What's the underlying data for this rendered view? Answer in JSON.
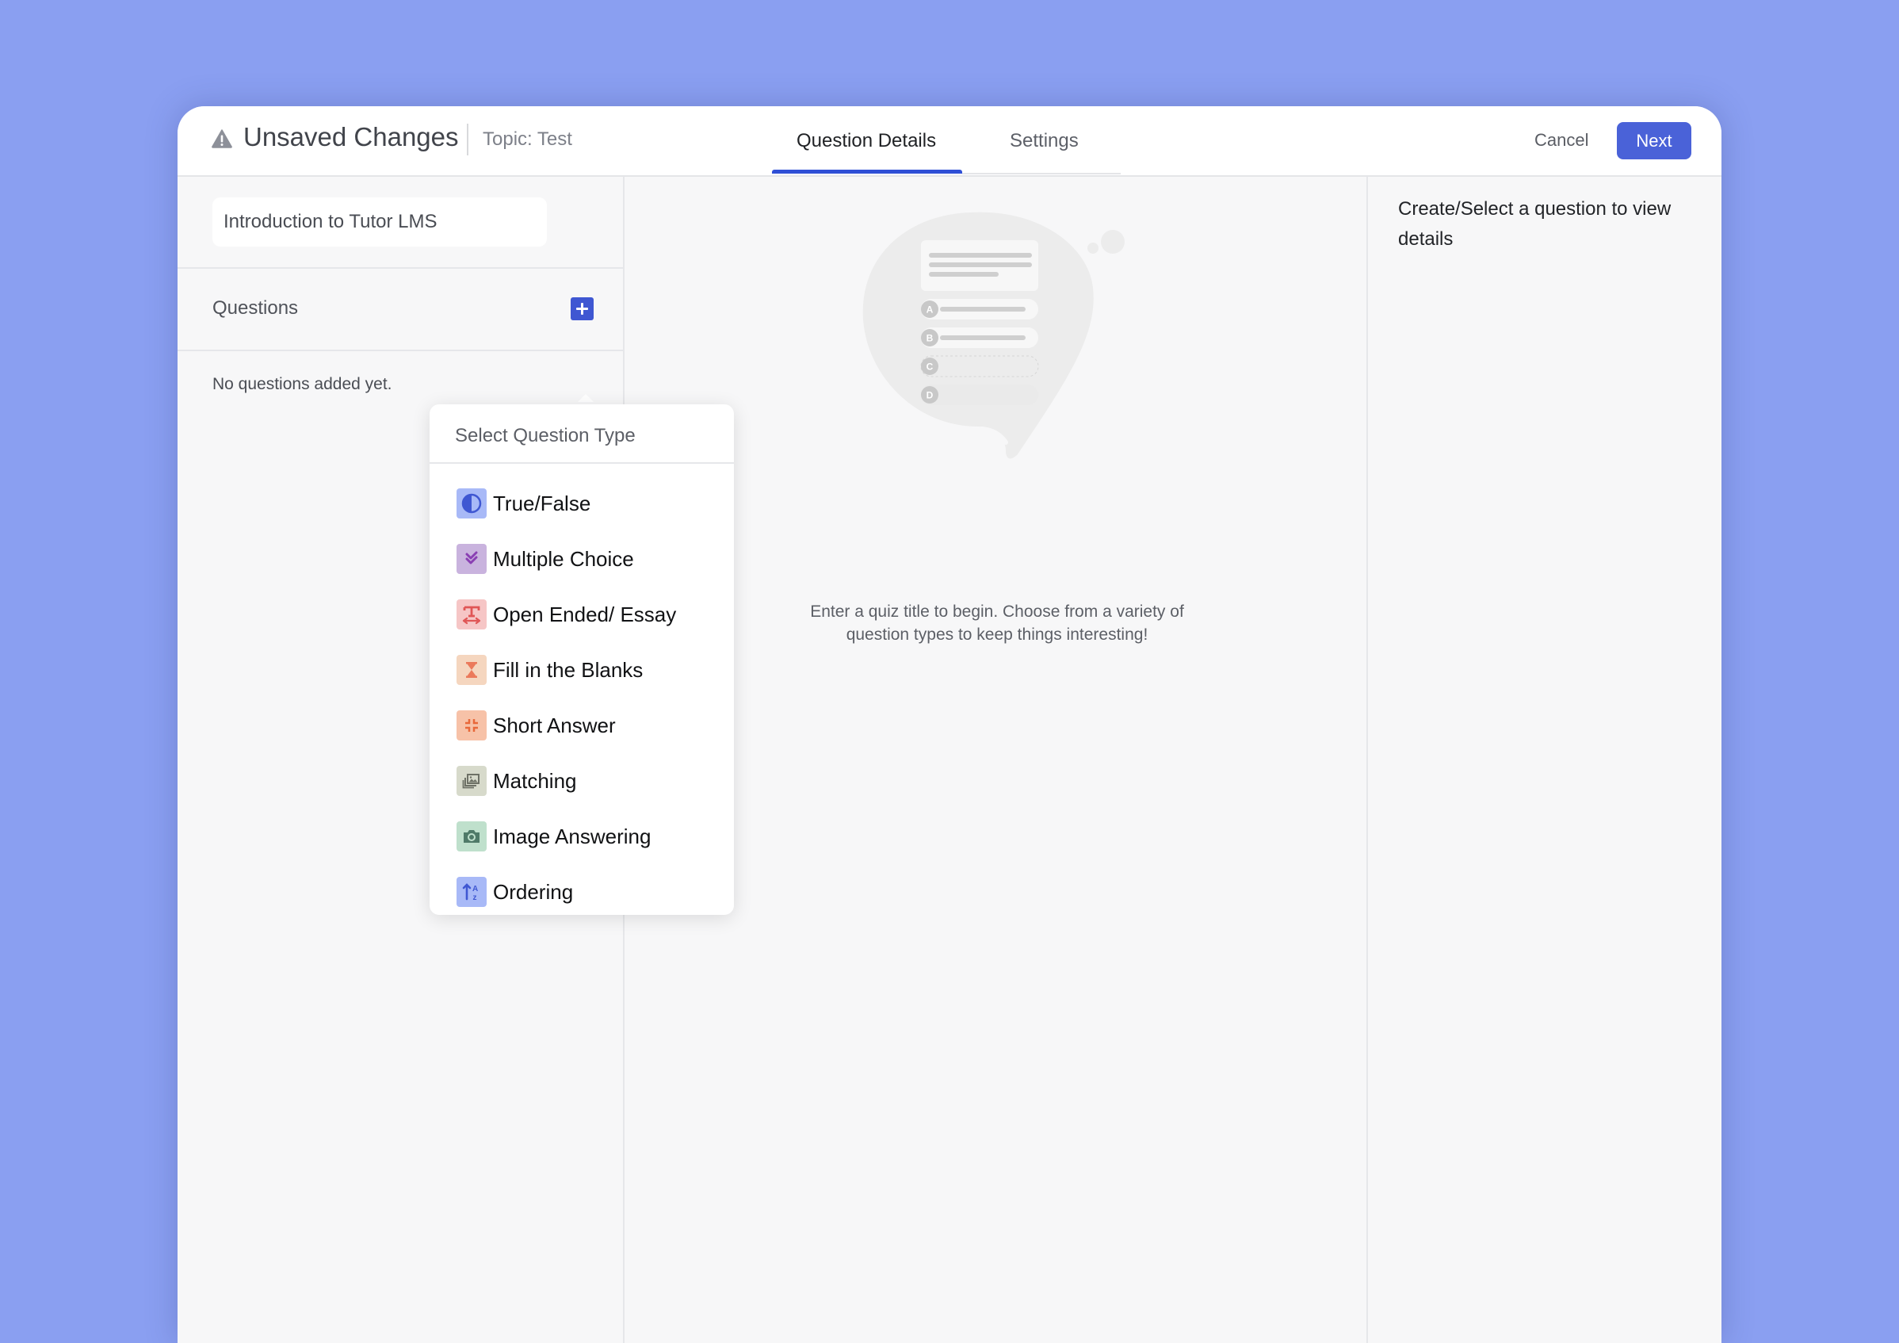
{
  "header": {
    "status_title": "Unsaved Changes",
    "topic": "Topic: Test",
    "tabs": [
      {
        "label": "Question Details",
        "active": true
      },
      {
        "label": "Settings",
        "active": false
      }
    ],
    "cancel_label": "Cancel",
    "next_label": "Next",
    "accent_color": "#4a62d8"
  },
  "left_panel": {
    "quiz_title_value": "Introduction to Tutor LMS",
    "questions_label": "Questions",
    "empty_message": "No questions added yet."
  },
  "dropdown": {
    "title": "Select Question Type",
    "items": [
      {
        "label": "True/False",
        "icon": "half-circle-icon",
        "bg": "#a8b9f7",
        "fg": "#3f57d2"
      },
      {
        "label": "Multiple Choice",
        "icon": "double-check-icon",
        "bg": "#c9b3de",
        "fg": "#8a3fb3"
      },
      {
        "label": "Open Ended/ Essay",
        "icon": "text-width-icon",
        "bg": "#f6c6c6",
        "fg": "#e05656"
      },
      {
        "label": "Fill in the Blanks",
        "icon": "hourglass-icon",
        "bg": "#f5d6bf",
        "fg": "#eb7a5b"
      },
      {
        "label": "Short Answer",
        "icon": "compress-icon",
        "bg": "#f7c2a8",
        "fg": "#e8683a"
      },
      {
        "label": "Matching",
        "icon": "images-icon",
        "bg": "#d7dacb",
        "fg": "#6e7166"
      },
      {
        "label": "Image Answering",
        "icon": "camera-icon",
        "bg": "#bfe0cc",
        "fg": "#4f7a68"
      },
      {
        "label": "Ordering",
        "icon": "sort-az-icon",
        "bg": "#a8b9f7",
        "fg": "#3f57d2"
      }
    ]
  },
  "main": {
    "empty_text": "Enter a quiz title to begin. Choose from a variety of question types to keep things interesting!",
    "illustration_options": [
      "A",
      "B",
      "C",
      "D"
    ]
  },
  "right_panel": {
    "message": "Create/Select a question to view details"
  }
}
